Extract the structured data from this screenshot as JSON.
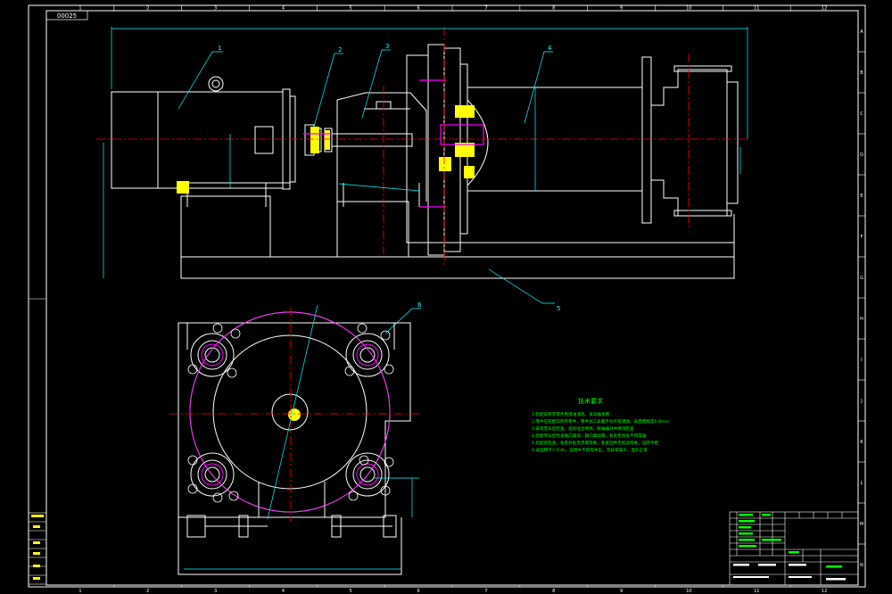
{
  "sheet": {
    "drawing_code": "00025",
    "col_numbers": [
      "1",
      "2",
      "3",
      "4",
      "5",
      "6",
      "7",
      "8",
      "9",
      "10",
      "11",
      "12"
    ],
    "row_letters": [
      "A",
      "B",
      "C",
      "D",
      "E",
      "F",
      "G",
      "H",
      "I",
      "J",
      "K",
      "L",
      "M",
      "N"
    ]
  },
  "balloons": [
    "1",
    "2",
    "3",
    "4",
    "5",
    "6"
  ],
  "notes": {
    "title": "技术要求",
    "lines": [
      "1.装配前所有零件用煤油清洗，滚动轴承用",
      "2.零件在装配前所有零件，零件加工表面不允许有锈蚀，表面粗糙度0.8mm",
      "3.安装完毕后检查，齿轮啮合侧隙，联轴器对中情况检查",
      "4.装配完毕后检查轴向窜动，轴向窜动量，各处密封处不得漏油",
      "5.装配后检查，各密封处无渗漏现象，各紧固件无松动现象，运转平稳",
      "6.试运转不少于4h，运转中不得有冲击，无异常噪声，温升正常"
    ]
  },
  "colors": {
    "background": "#000000",
    "frame": "#ffffff",
    "dimension": "#00ffff",
    "notes": "#00ff00",
    "centerline": "#ff0000",
    "highlight": "#ffff00",
    "magenta": "#ff00ff"
  }
}
